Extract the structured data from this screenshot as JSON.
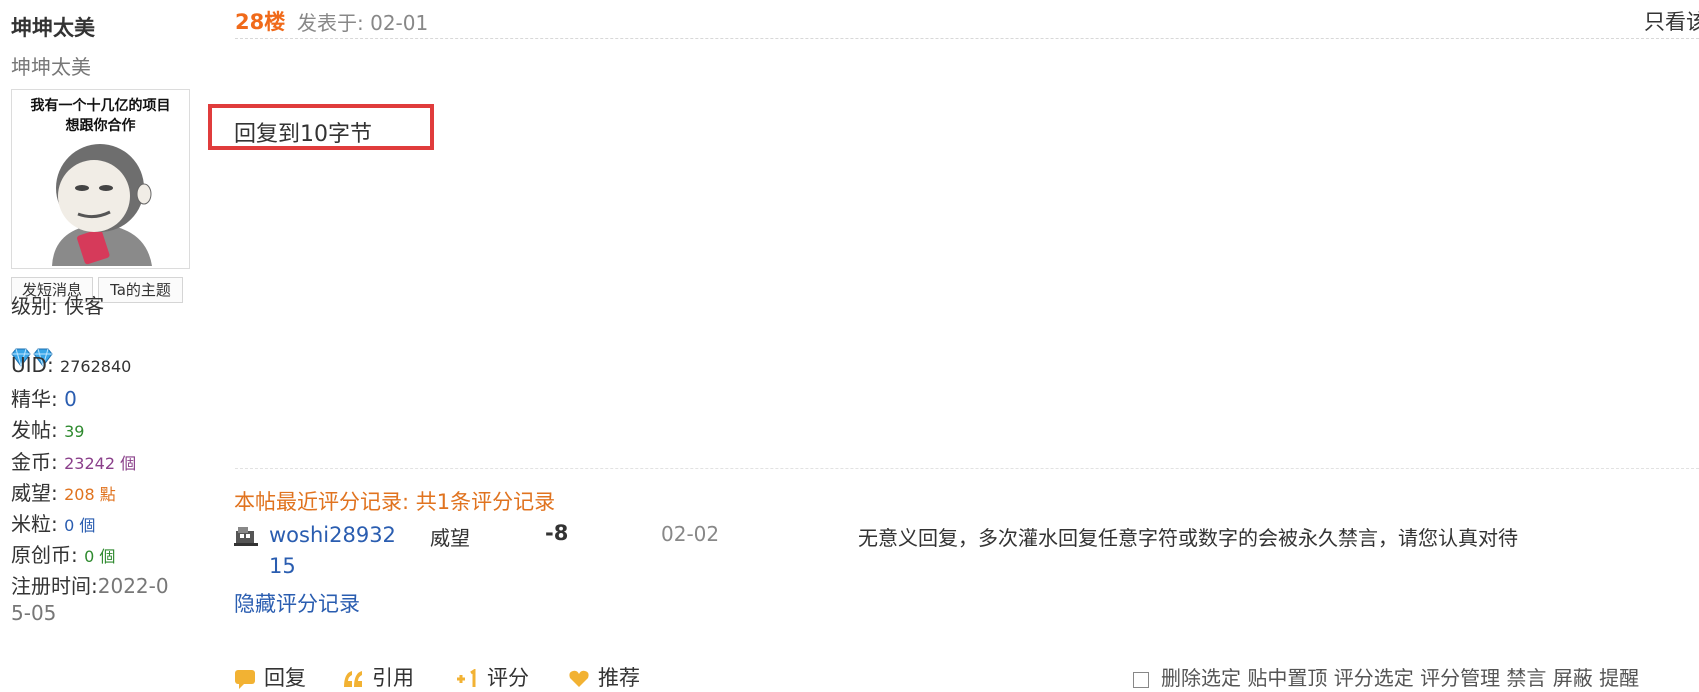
{
  "user": {
    "name": "坤坤太美",
    "nickname": "坤坤太美",
    "avatar_caption_line1": "我有一个十几亿的项目",
    "avatar_caption_line2": "想跟你合作",
    "send_message_label": "发短消息",
    "topics_label": "Ta的主题",
    "level_label": "级别:",
    "level_value": "侠客",
    "uid_label": "UID:",
    "uid_value": "2762840",
    "essence_label": "精华:",
    "essence_value": "0",
    "posts_label": "发帖:",
    "posts_value": "39",
    "gold_label": "金币:",
    "gold_value": "23242 個",
    "prestige_label": "威望:",
    "prestige_value": "208 點",
    "rice_label": "米粒:",
    "rice_value": "0 個",
    "original_coin_label": "原创币:",
    "original_coin_value": "0 個",
    "register_label": "注册时间:",
    "register_value_line1": "2022-0",
    "register_value_line2": "5-05",
    "gem_icons": [
      "diamond-icon",
      "diamond-icon"
    ]
  },
  "post": {
    "floor": "28楼",
    "posted_at": "发表于: 02-01",
    "only_view_label": "只看该",
    "content": "回复到10字节"
  },
  "rating": {
    "title": "本帖最近评分记录: 共1条评分记录",
    "record": {
      "user": "woshi2893215",
      "type": "威望",
      "score": "-8",
      "date": "02-02",
      "reason": "无意义回复，多次灌水回复任意字符或数字的会被永久禁言，请您认真对待"
    },
    "hide_label": "隐藏评分记录"
  },
  "actions": {
    "reply": "回复",
    "quote": "引用",
    "rate": "评分",
    "recommend": "推荐",
    "admin": "删除选定 贴中置顶 评分选定 评分管理 禁言 屏蔽 提醒"
  },
  "colors": {
    "accent_orange": "#f06a1a",
    "link_blue": "#2a5db0",
    "highlight_red": "#e03c3c"
  }
}
